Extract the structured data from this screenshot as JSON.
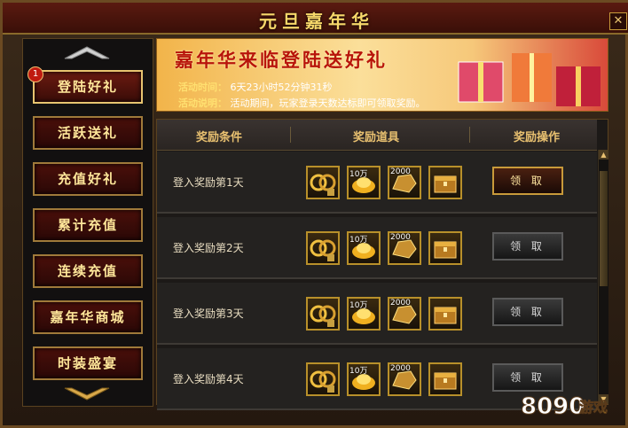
{
  "window": {
    "title": "元旦嘉年华",
    "close_glyph": "✕"
  },
  "sidebar": {
    "badge": "1",
    "items": [
      {
        "label": "登陆好礼"
      },
      {
        "label": "活跃送礼"
      },
      {
        "label": "充值好礼"
      },
      {
        "label": "累计充值"
      },
      {
        "label": "连续充值"
      },
      {
        "label": "嘉年华商城"
      },
      {
        "label": "时装盛宴"
      }
    ]
  },
  "banner": {
    "title": "嘉年华来临登陆送好礼",
    "time_label": "活动时间：",
    "time_value": "6天23小时52分钟31秒",
    "desc_label": "活动说明：",
    "desc_value": "活动期间，玩家登录天数达标即可领取奖励。"
  },
  "table": {
    "headers": [
      "奖励条件",
      "奖励道具",
      "奖励操作"
    ],
    "rows": [
      {
        "label": "登入奖励第1天",
        "items": [
          "",
          "10万",
          "2000",
          ""
        ],
        "action": "领 取",
        "enabled": true
      },
      {
        "label": "登入奖励第2天",
        "items": [
          "",
          "10万",
          "2000",
          ""
        ],
        "action": "领 取",
        "enabled": false
      },
      {
        "label": "登入奖励第3天",
        "items": [
          "",
          "10万",
          "2000",
          ""
        ],
        "action": "领 取",
        "enabled": false
      },
      {
        "label": "登入奖励第4天",
        "items": [
          "",
          "10万",
          "2000",
          ""
        ],
        "action": "领 取",
        "enabled": false
      }
    ]
  },
  "watermark": {
    "number": "8090",
    "text": "游戏"
  },
  "colors": {
    "gold": "#e8c070",
    "accent_red": "#b8140a",
    "frame": "#6b4a22"
  },
  "icons": {
    "item_types": [
      "gold-ring-bundle-icon",
      "gold-ingot-icon",
      "gold-armor-icon",
      "treasure-chest-icon"
    ]
  }
}
